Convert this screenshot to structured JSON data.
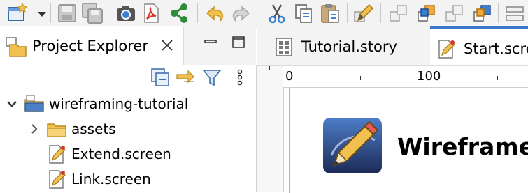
{
  "toolbar": {
    "buttons": [
      {
        "name": "new-icon"
      },
      {
        "name": "dropdown-arrow-icon"
      },
      {
        "name": "save-icon"
      },
      {
        "name": "save-all-icon"
      },
      {
        "name": "screenshot-icon"
      },
      {
        "name": "pdf-icon"
      },
      {
        "name": "share-icon"
      },
      {
        "name": "undo-icon"
      },
      {
        "name": "redo-icon"
      },
      {
        "name": "cut-icon"
      },
      {
        "name": "copy-icon"
      },
      {
        "name": "paste-icon"
      },
      {
        "name": "edit-pen-icon"
      },
      {
        "name": "bring-to-front-icon"
      },
      {
        "name": "bring-forward-icon"
      },
      {
        "name": "send-backward-icon"
      },
      {
        "name": "send-to-back-icon"
      },
      {
        "name": "align-icon"
      }
    ]
  },
  "project_explorer": {
    "title": "Project Explorer",
    "tree": [
      {
        "label": "wireframing-tutorial",
        "type": "project",
        "expanded": true
      },
      {
        "label": "assets",
        "type": "folder",
        "expanded": false
      },
      {
        "label": "Extend.screen",
        "type": "screen"
      },
      {
        "label": "Link.screen",
        "type": "screen"
      }
    ]
  },
  "editor": {
    "tabs": [
      {
        "label": "Tutorial.story",
        "active": false
      },
      {
        "label": "Start.scre",
        "active": true
      }
    ],
    "ruler": {
      "tick_0": "0",
      "tick_100": "100"
    },
    "canvas_title": "Wireframe"
  },
  "colors": {
    "accent": "#3c78c8",
    "folder": "#f2c04f",
    "share": "#2e8b3a",
    "pdf": "#d9342b"
  }
}
